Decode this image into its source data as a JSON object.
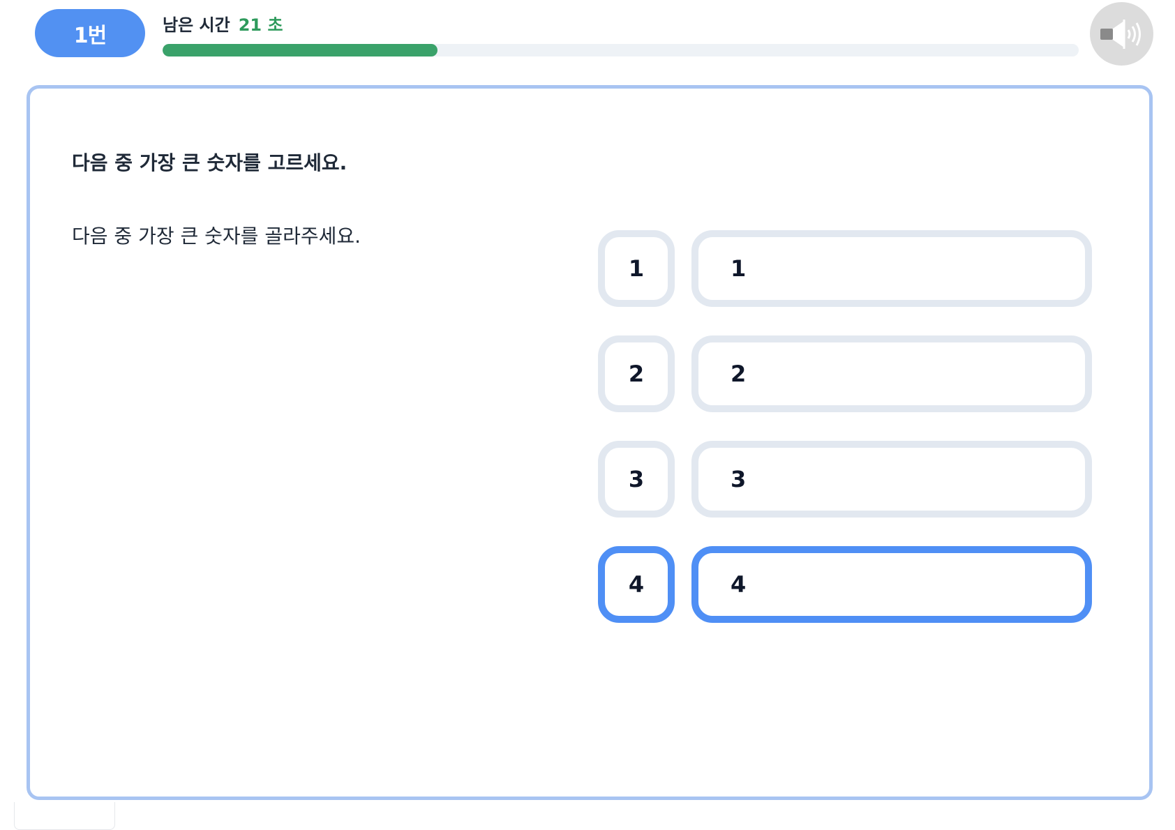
{
  "header": {
    "question_badge": "1번",
    "timer_label": "남은 시간",
    "timer_value": "21 초",
    "progress": 0.3,
    "sound_icon": "speaker-icon"
  },
  "question": {
    "title": "다음 중 가장 큰 숫자를 고르세요.",
    "body": "다음 중 가장 큰 숫자를 골라주세요."
  },
  "choices": [
    {
      "number": "1",
      "text": "1",
      "selected": false
    },
    {
      "number": "2",
      "text": "2",
      "selected": false
    },
    {
      "number": "3",
      "text": "3",
      "selected": false
    },
    {
      "number": "4",
      "text": "4",
      "selected": true
    }
  ],
  "colors": {
    "accent": "#5291f2",
    "selected_border": "#4f8ff5",
    "progress_fill": "#3aa26a",
    "timer_value": "#2e9a5c",
    "card_border": "#a8c4f2"
  }
}
